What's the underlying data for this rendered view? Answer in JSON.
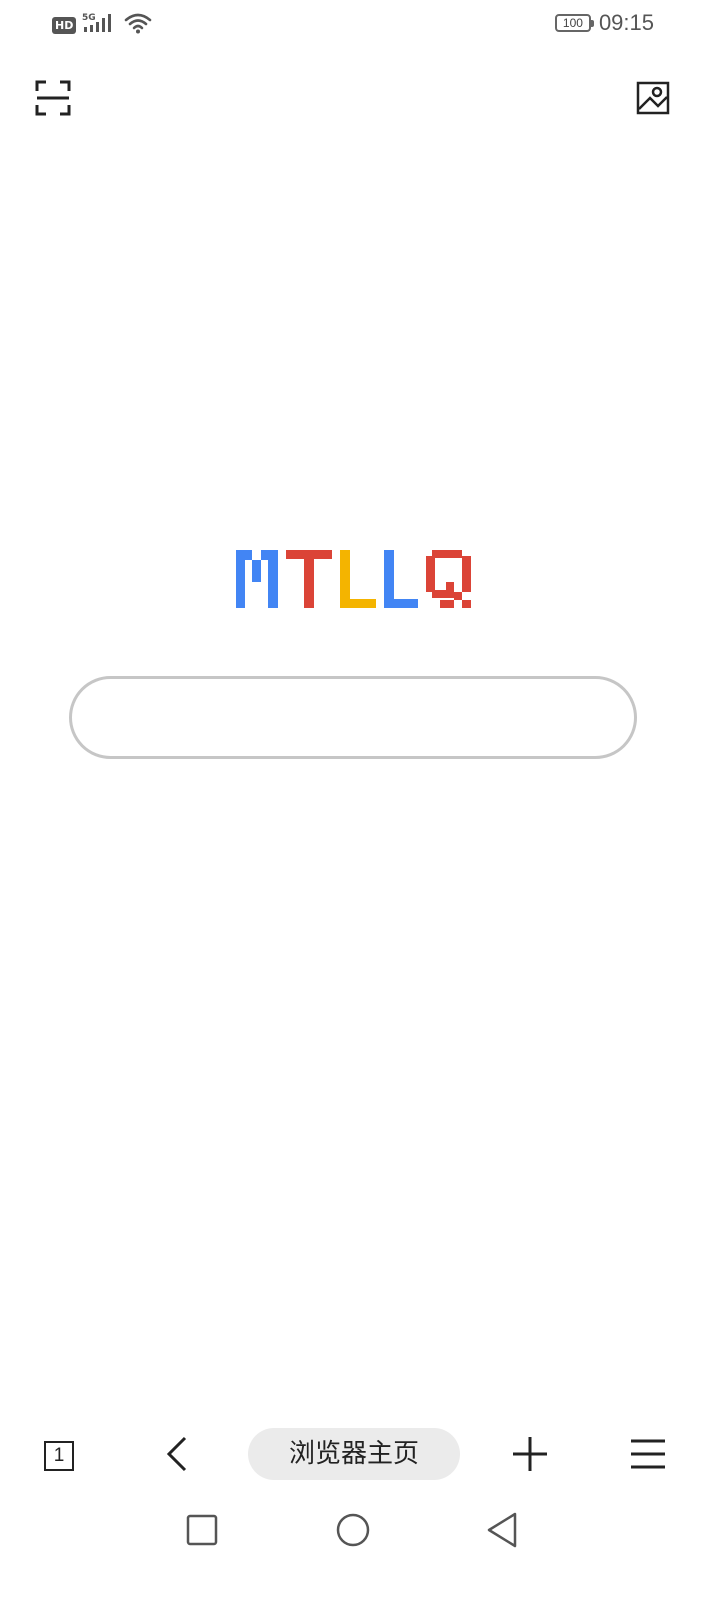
{
  "status_bar": {
    "hd_label": "HD",
    "network": "5G",
    "signal_icon": "signal-bars-icon",
    "wifi_icon": "wifi-icon",
    "battery_level": "100",
    "time": "09:15"
  },
  "top_actions": {
    "scan_icon": "scan-icon",
    "image_search_icon": "image-search-icon"
  },
  "logo": {
    "text": "MTLLQ",
    "letters": [
      {
        "char": "M",
        "color": "#4285F4"
      },
      {
        "char": "T",
        "color": "#DB4437"
      },
      {
        "char": "L",
        "color": "#F4B400"
      },
      {
        "char": "L",
        "color": "#4285F4"
      },
      {
        "char": "Q",
        "color": "#DB4437"
      }
    ]
  },
  "search": {
    "value": "",
    "placeholder": ""
  },
  "toolbar": {
    "tab_count": "1",
    "back_icon": "chevron-left-icon",
    "home_label": "浏览器主页",
    "new_tab_icon": "plus-icon",
    "menu_icon": "menu-icon"
  },
  "system_nav": {
    "recents_icon": "square-icon",
    "home_icon": "circle-icon",
    "back_icon": "triangle-back-icon"
  }
}
